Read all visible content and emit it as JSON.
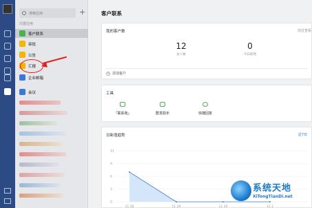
{
  "search": {
    "placeholder": "搜索应用"
  },
  "panel": {
    "section_label": "内置应用",
    "apps": [
      {
        "label": "客户联系",
        "color": "#4caf50"
      },
      {
        "label": "审批",
        "color": "#f5b400"
      },
      {
        "label": "公告",
        "color": "#f5b400"
      },
      {
        "label": "汇报",
        "color": "#f5b400"
      },
      {
        "label": "企业邮箱",
        "color": "#3b78d8"
      },
      {
        "label": "会议",
        "color": "#3b78d8"
      }
    ]
  },
  "main": {
    "title": "客户联系",
    "customers_card": {
      "heading": "我的客户数",
      "link": "前往查看",
      "total_value": "12",
      "total_label": "总人数",
      "new_value": "0",
      "new_label": "今日新增",
      "add_label": "添加客户"
    },
    "tools_card": {
      "heading": "工具",
      "tools": [
        {
          "label": "「联系我」",
          "icon": "contact-me-icon"
        },
        {
          "label": "群发助手",
          "icon": "broadcast-icon"
        },
        {
          "label": "快捷回复",
          "icon": "quick-reply-icon"
        }
      ]
    },
    "trend_card": {
      "heading": "日新增趋势",
      "range_link": "近7日"
    }
  },
  "chart_data": {
    "type": "area",
    "x": [
      "11.28",
      "11.29",
      "11.30",
      "12.1"
    ],
    "values": [
      7,
      0,
      0,
      0
    ],
    "y_ticks": [
      0,
      3,
      6,
      9,
      12
    ],
    "ylim": [
      0,
      12
    ]
  },
  "watermark": {
    "title": "系统天地",
    "subtitle": "XiTongTianDi.net"
  },
  "colors": {
    "rail": "#2c4a83",
    "accent": "#3b78d8",
    "annotation": "#e01c1c"
  }
}
